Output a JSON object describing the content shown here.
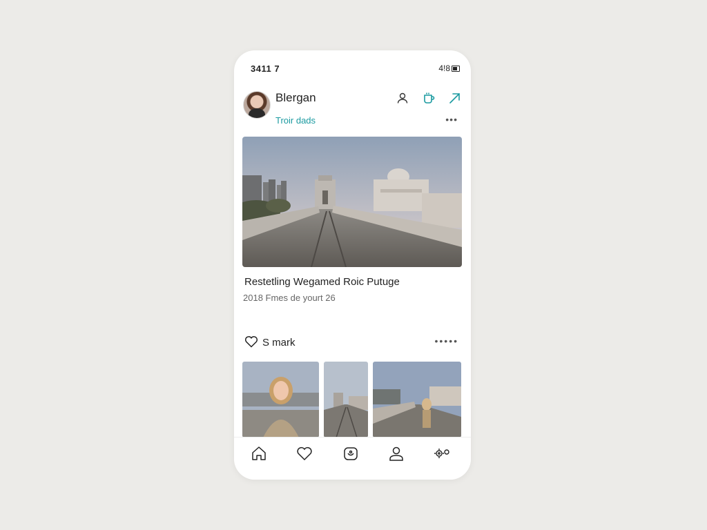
{
  "status_bar": {
    "time": "3411 7",
    "signal": "4!8"
  },
  "profile": {
    "username": "Blergan",
    "subtitle": "Troir dads",
    "icons": [
      "person-icon",
      "cup-icon",
      "share-arrow-icon",
      "more-icon"
    ],
    "accent_color": "#1a9aa0"
  },
  "post": {
    "image": "bridge-cityscape-photo",
    "title": "Restetling Wegamed Roic Putuge",
    "meta": "2018 Fmes de yourt 26"
  },
  "likes": {
    "label": "S mark",
    "icon": "heart-icon"
  },
  "thumbnails": [
    "woman-on-bridge-photo",
    "bridge-gate-photo",
    "woman-on-bridge-far-photo"
  ],
  "tab_bar": {
    "tabs": [
      "home-icon",
      "heart-icon",
      "camera-icon",
      "profile-icon",
      "settings-icon"
    ]
  }
}
